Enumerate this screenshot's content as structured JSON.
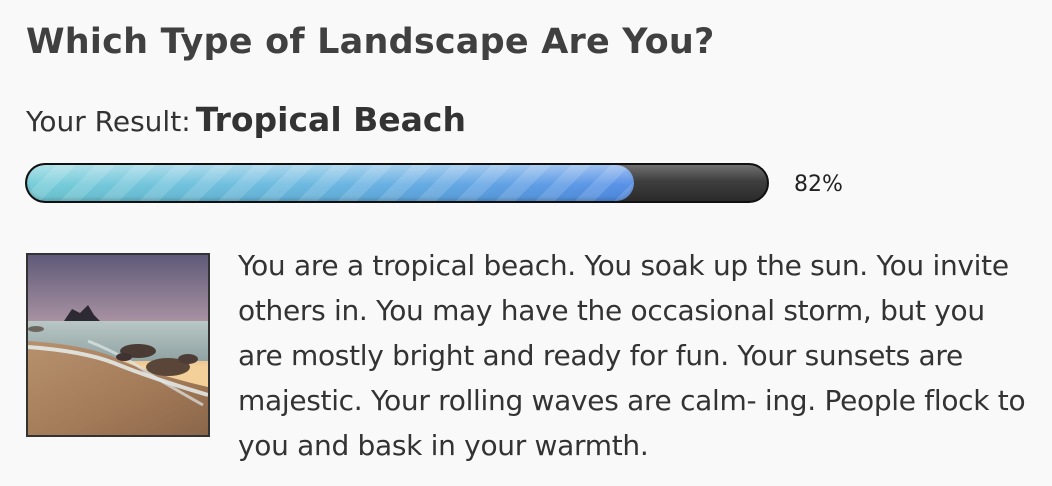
{
  "quiz": {
    "title": "Which Type of Landscape Are You?"
  },
  "result": {
    "prefix": "Your Result:",
    "name": "Tropical Beach",
    "percent": 82,
    "percent_label": "82%",
    "image_subject": "tropical-beach-sunset-photo",
    "description": "You are a tropical beach. You soak up the sun. You invite others in. You may have the occasional storm, but you are mostly bright and ready for fun. Your sunsets are majestic. Your rolling waves are calm- ing. People flock to you and bask in your warmth."
  },
  "colors": {
    "bar_fill_start": "#6fcbd6",
    "bar_fill_end": "#4f8be5",
    "bar_track": "#3e3e3e",
    "text": "#333333"
  }
}
